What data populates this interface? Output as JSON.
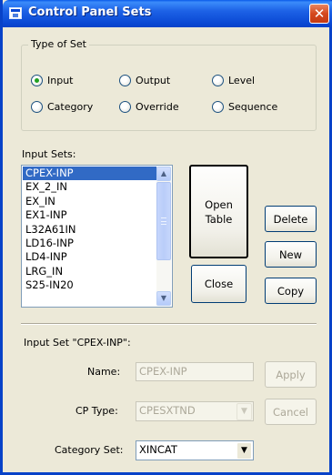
{
  "window": {
    "title": "Control Panel Sets",
    "close_glyph": "✕"
  },
  "type_of_set": {
    "legend": "Type of Set",
    "options": [
      {
        "label": "Input",
        "checked": true
      },
      {
        "label": "Output",
        "checked": false
      },
      {
        "label": "Level",
        "checked": false
      },
      {
        "label": "Category",
        "checked": false
      },
      {
        "label": "Override",
        "checked": false
      },
      {
        "label": "Sequence",
        "checked": false
      }
    ]
  },
  "input_sets": {
    "label": "Input Sets:",
    "items": [
      "CPEX-INP",
      "EX_2_IN",
      "EX_IN",
      "EX1-INP",
      "L32A61IN",
      "LD16-INP",
      "LD4-INP",
      "LRG_IN",
      "S25-IN20"
    ],
    "selected": "CPEX-INP",
    "scroll_up_glyph": "▲",
    "scroll_down_glyph": "▼"
  },
  "buttons": {
    "open_line1": "Open",
    "open_line2": "Table",
    "close": "Close",
    "delete": "Delete",
    "new": "New",
    "copy": "Copy",
    "apply": "Apply",
    "cancel": "Cancel"
  },
  "details": {
    "heading": "Input Set \"CPEX-INP\":",
    "name_label": "Name:",
    "name_value": "CPEX-INP",
    "cp_type_label": "CP Type:",
    "cp_type_value": "CPESXTND",
    "category_set_label": "Category Set:",
    "category_set_value": "XINCAT",
    "dropdown_glyph": "▼"
  },
  "colors": {
    "title_bar": "#0A48D4",
    "dialog_bg": "#ECE9D8",
    "selection": "#316AC5",
    "close_button": "#D5491F"
  },
  "icons": {
    "title": "window-icon",
    "close": "close-icon",
    "scroll_up": "chevron-up-icon",
    "scroll_down": "chevron-down-icon",
    "dropdown": "chevron-down-icon"
  }
}
